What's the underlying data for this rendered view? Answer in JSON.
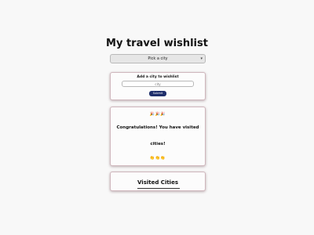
{
  "header": {
    "title": "My travel wishlist"
  },
  "city_select": {
    "selected": "Pick a city",
    "icon": "chevron-down-icon"
  },
  "add_city": {
    "label": "Add a city to wishlist",
    "input_placeholder": "city",
    "submit_label": "Submit"
  },
  "congrats": {
    "emoji_top": "🎉🎉🎉",
    "line_1": "Congratulations! You have visited",
    "line_2": "cities!",
    "emoji_bottom": "👏👏👏"
  },
  "visited": {
    "title": "Visited Cities"
  }
}
